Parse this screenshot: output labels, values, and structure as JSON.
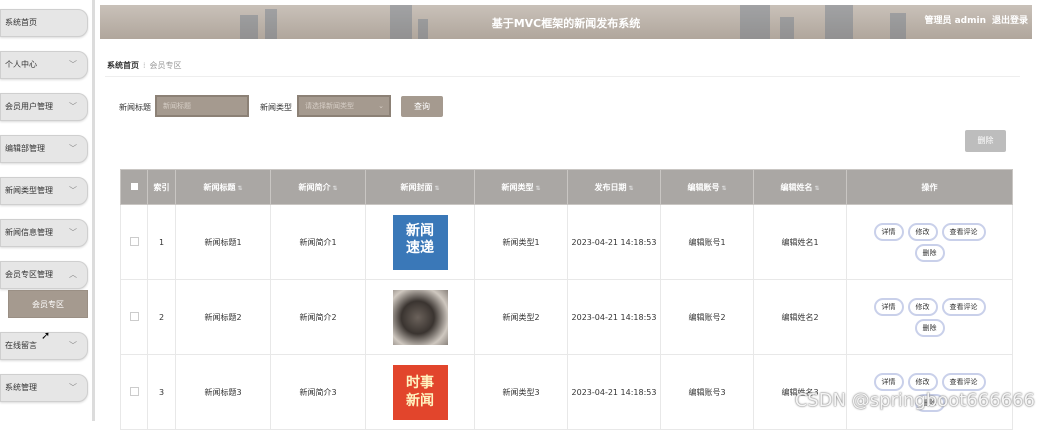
{
  "sidebar": {
    "items": [
      {
        "label": "系统首页",
        "chevron": false
      },
      {
        "label": "个人中心",
        "chevron": true
      },
      {
        "label": "会员用户管理",
        "chevron": true
      },
      {
        "label": "编辑部管理",
        "chevron": true
      },
      {
        "label": "新闻类型管理",
        "chevron": true
      },
      {
        "label": "新闻信息管理",
        "chevron": true
      },
      {
        "label": "会员专区管理",
        "chevron": true
      },
      {
        "label": "在线留言",
        "chevron": true
      },
      {
        "label": "系统管理",
        "chevron": true
      }
    ],
    "sub_item": "会员专区"
  },
  "header": {
    "title": "基于MVC框架的新闻发布系统",
    "user": "管理员 admin",
    "logout": "退出登录"
  },
  "breadcrumb": {
    "home": "系统首页",
    "current": "会员专区"
  },
  "search": {
    "title_label": "新闻标题",
    "title_placeholder": "新闻标题",
    "type_label": "新闻类型",
    "type_placeholder": "请选择新闻类型",
    "query_button": "查询"
  },
  "delete_button": "删除",
  "table": {
    "headers": [
      "索引",
      "新闻标题",
      "新闻简介",
      "新闻封面",
      "新闻类型",
      "发布日期",
      "编辑账号",
      "编辑姓名",
      "操作"
    ],
    "rows": [
      {
        "index": "1",
        "title": "新闻标题1",
        "summary": "新闻简介1",
        "cover_text": "新闻\n速递",
        "type": "新闻类型1",
        "date": "2023-04-21 14:18:53",
        "account": "编辑账号1",
        "name": "编辑姓名1"
      },
      {
        "index": "2",
        "title": "新闻标题2",
        "summary": "新闻简介2",
        "cover_text": "",
        "type": "新闻类型2",
        "date": "2023-04-21 14:18:53",
        "account": "编辑账号2",
        "name": "编辑姓名2"
      },
      {
        "index": "3",
        "title": "新闻标题3",
        "summary": "新闻简介3",
        "cover_text": "时事\n新闻",
        "type": "新闻类型3",
        "date": "2023-04-21 14:18:53",
        "account": "编辑账号3",
        "name": "编辑姓名3"
      }
    ],
    "actions": [
      "详情",
      "修改",
      "查看评论",
      "删除"
    ]
  },
  "watermark": "CSDN @springboot666666",
  "colors": {
    "accent": "#a59a8f",
    "header_bg": "#b9afa5",
    "table_header": "#aaa7a4"
  }
}
